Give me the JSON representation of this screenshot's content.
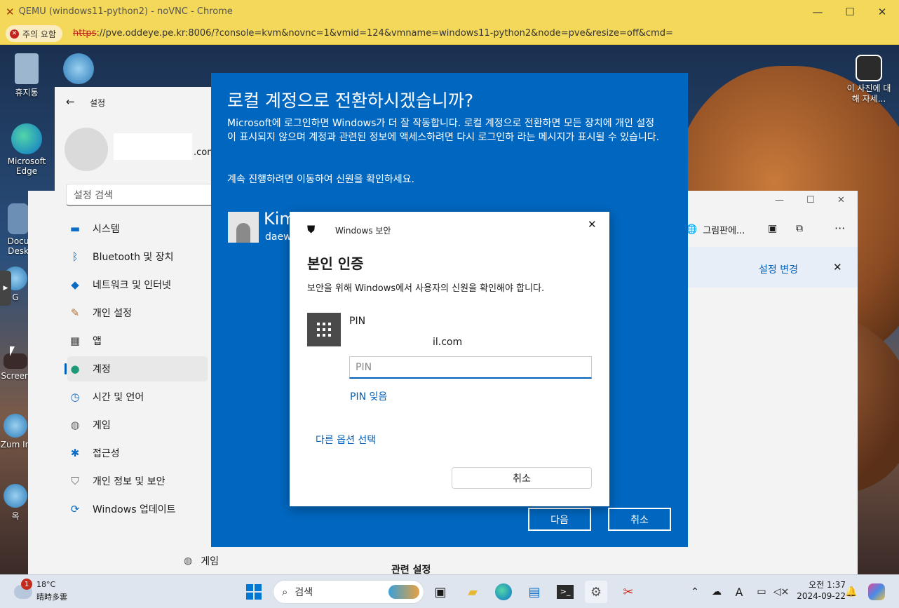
{
  "browser": {
    "title": "QEMU (windows11-python2) - noVNC - Chrome",
    "warning": "주의 요함",
    "url_scheme": "https",
    "url_rest": "://pve.oddeye.pe.kr:8006/?console=kvm&novnc=1&vmid=124&vmname=windows11-python2&node=pve&resize=off&cmd="
  },
  "desktop": {
    "icons": [
      "휴지통",
      "Microsoft Edge",
      "Docu Desk",
      "G",
      "Screen",
      "Zum In",
      "옥"
    ],
    "photo_label": "이 사진에 대해 자세..."
  },
  "settings": {
    "title": "설정",
    "email_suffix": ".com",
    "search_placeholder": "설정 검색",
    "nav": [
      {
        "label": "시스템",
        "icon": "display-icon"
      },
      {
        "label": "Bluetooth 및 장치",
        "icon": "bluetooth-icon"
      },
      {
        "label": "네트워크 및 인터넷",
        "icon": "wifi-icon"
      },
      {
        "label": "개인 설정",
        "icon": "brush-icon"
      },
      {
        "label": "앱",
        "icon": "apps-icon"
      },
      {
        "label": "계정",
        "icon": "account-icon"
      },
      {
        "label": "시간 및 언어",
        "icon": "clock-icon"
      },
      {
        "label": "게임",
        "icon": "gamepad-icon"
      },
      {
        "label": "접근성",
        "icon": "accessibility-icon"
      },
      {
        "label": "개인 정보 및 보안",
        "icon": "shield-icon"
      },
      {
        "label": "Windows 업데이트",
        "icon": "update-icon"
      }
    ],
    "behind_game": "게임",
    "behind_related": "관련 설정"
  },
  "paint_window": {
    "label": "그림판에...",
    "change_settings": "설정 변경"
  },
  "switch_dialog": {
    "title": "로컬 계정으로 전환하시겠습니까?",
    "body1": "Microsoft에 로그인하면 Windows가 더 잘 작동합니다. 로컬 계정으로 전환하면 모든 장치에 개인 설정이 표시되지 않으며 계정과 관련된 정보에 액세스하려면 다시 로그인하 라는 메시지가 표시될 수 있습니다.",
    "body2": "계속 진행하려면 이동하여 신원을 확인하세요.",
    "user_name": "Kim",
    "user_email": "daew",
    "next_button": "다음",
    "cancel_button": "취소"
  },
  "security_dialog": {
    "app_name": "Windows 보안",
    "heading": "본인 인증",
    "description": "보안을 위해 Windows에서 사용자의 신원을 확인해야 합니다.",
    "method": "PIN",
    "account": "il.com",
    "pin_placeholder": "PIN",
    "forgot_pin": "PIN 잊음",
    "other_options": "다른 옵션 선택",
    "cancel": "취소"
  },
  "taskbar": {
    "weather_temp": "18°C",
    "weather_desc": "晴時多雲",
    "weather_badge": "1",
    "search_label": "검색",
    "time": "오전 1:37",
    "date": "2024-09-22"
  }
}
